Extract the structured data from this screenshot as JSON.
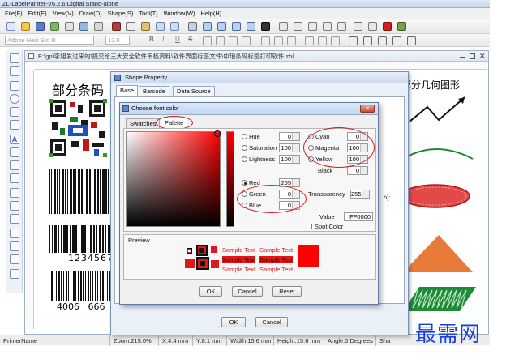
{
  "window": {
    "title": "ZL-LabelPainter-V6.2.6 Digital Stand-alone"
  },
  "menu": {
    "items": [
      "File(F)",
      "Edit(E)",
      "View(V)",
      "Draw(D)",
      "Shape(S)",
      "Tool(T)",
      "Window(W)",
      "Help(H)"
    ]
  },
  "toolbar2": {
    "font_name": "Adobe Heiti Std R",
    "font_size": "12.0",
    "bold": "B",
    "italic": "I",
    "underline": "U",
    "strike": "S"
  },
  "document": {
    "path": "E:\\gp\\李旭发过来的\\提交给三大安全软件审核资料\\软件界面标签文件\\中琅条码标签打印软件.zhl",
    "heading_left": "部分条码",
    "heading_right": "部分几何图形",
    "barcode_text_1": "1234567",
    "barcode_text_2": "4006   666"
  },
  "shape_property": {
    "title": "Shape Property",
    "tabs": [
      "Base",
      "Barcode",
      "Data Source"
    ],
    "ok_label": "OK",
    "cancel_label": "Cancel",
    "side_text": "h):"
  },
  "font_color": {
    "title": "Choose font color",
    "tabs": [
      "Swatches",
      "Palette"
    ],
    "hsl": [
      {
        "label": "Hue",
        "value": "0"
      },
      {
        "label": "Saturation",
        "value": "100"
      },
      {
        "label": "Lightness",
        "value": "100"
      }
    ],
    "cmyk": [
      {
        "label": "Cyan",
        "value": "0"
      },
      {
        "label": "Magenta",
        "value": "100"
      },
      {
        "label": "Yellow",
        "value": "100"
      },
      {
        "label": "Black",
        "value": "0"
      }
    ],
    "rgb": [
      {
        "label": "Red",
        "value": "255"
      },
      {
        "label": "Green",
        "value": "0"
      },
      {
        "label": "Blue",
        "value": "0"
      }
    ],
    "transparency_label": "Transparency",
    "transparency_value": "255",
    "value_label": "Value",
    "value_text": "FF0000",
    "spot_color_label": "Spot Color",
    "preview_label": "Preview",
    "sample_text": "Sample Text",
    "ok_label": "OK",
    "cancel_label": "Cancel",
    "reset_label": "Reset",
    "selected_color": "#ff0000"
  },
  "status": {
    "printer": "PrinterName",
    "zoom": "Zoom:215.0%",
    "x": "X:4.4 mm",
    "y": "Y:8.1 mm",
    "width": "Width:15.6 mm",
    "height": "Height:15.6 mm",
    "angle": "Angle:0 Degrees",
    "extra": "Sha"
  },
  "watermark": "最需网",
  "icons": {
    "close": "close-icon",
    "dialog": "dialog-icon"
  }
}
